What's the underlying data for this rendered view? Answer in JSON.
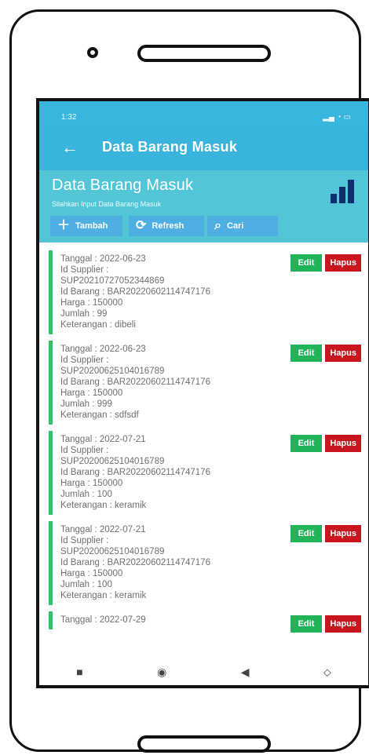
{
  "status_bar": {
    "time": "1:32",
    "right_icons": "signal-wifi-battery"
  },
  "appbar": {
    "back_label": "←",
    "title": "Data Barang Masuk"
  },
  "hero": {
    "title": "Data Barang Masuk",
    "subtitle": "Silahkan Input Data Barang Masuk",
    "icon": "bar-chart-icon"
  },
  "actions": {
    "tambah": "Tambah",
    "refresh": "Refresh",
    "cari": "Cari"
  },
  "items": [
    {
      "tanggal": "Tanggal : 2022-06-23",
      "supplier_label": "Id Supplier :",
      "supplier_id": "SUP20210727052344869",
      "barang": "Id Barang : BAR20220602114747176",
      "harga": "Harga : 150000",
      "jumlah": "Jumlah : 99",
      "keterangan": "Keterangan : dibeli",
      "edit": "Edit",
      "hapus": "Hapus"
    },
    {
      "tanggal": "Tanggal : 2022-06-23",
      "supplier_label": "Id Supplier :",
      "supplier_id": "SUP20200625104016789",
      "barang": "Id Barang : BAR20220602114747176",
      "harga": "Harga : 150000",
      "jumlah": "Jumlah : 999",
      "keterangan": "Keterangan : sdfsdf",
      "edit": "Edit",
      "hapus": "Hapus"
    },
    {
      "tanggal": "Tanggal : 2022-07-21",
      "supplier_label": "Id Supplier :",
      "supplier_id": "SUP20200625104016789",
      "barang": "Id Barang : BAR20220602114747176",
      "harga": "Harga : 150000",
      "jumlah": "Jumlah : 100",
      "keterangan": "Keterangan : keramik",
      "edit": "Edit",
      "hapus": "Hapus"
    },
    {
      "tanggal": "Tanggal : 2022-07-21",
      "supplier_label": "Id Supplier :",
      "supplier_id": "SUP20200625104016789",
      "barang": "Id Barang : BAR20220602114747176",
      "harga": "Harga : 150000",
      "jumlah": "Jumlah : 100",
      "keterangan": "Keterangan : keramik",
      "edit": "Edit",
      "hapus": "Hapus"
    },
    {
      "tanggal": "Tanggal : 2022-07-29",
      "supplier_label": "",
      "supplier_id": "",
      "barang": "",
      "harga": "",
      "jumlah": "",
      "keterangan": "",
      "edit": "Edit",
      "hapus": "Hapus"
    }
  ],
  "navbar": {
    "recent": "■",
    "home": "◉",
    "back": "◀",
    "more": "⬦"
  },
  "colors": {
    "header": "#39b4dc",
    "hero": "#52c6d7",
    "edit": "#21b35a",
    "hapus": "#c9151d",
    "accent_border": "#2fc46b"
  }
}
